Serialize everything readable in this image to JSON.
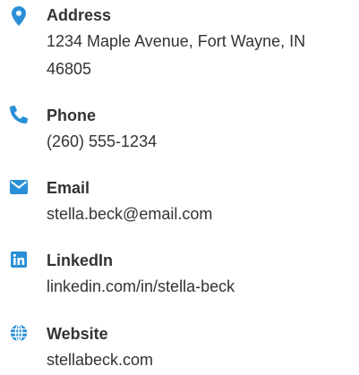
{
  "accent_color": "#2a8fd6",
  "contacts": {
    "address": {
      "icon": "map-pin-icon",
      "label": "Address",
      "value": "1234 Maple Avenue, Fort Wayne, IN 46805"
    },
    "phone": {
      "icon": "phone-icon",
      "label": "Phone",
      "value": "(260) 555-1234"
    },
    "email": {
      "icon": "envelope-icon",
      "label": "Email",
      "value": "stella.beck@email.com"
    },
    "linkedin": {
      "icon": "linkedin-icon",
      "label": "LinkedIn",
      "value": "linkedin.com/in/stella-beck"
    },
    "website": {
      "icon": "globe-icon",
      "label": "Website",
      "value": "stellabeck.com"
    }
  }
}
